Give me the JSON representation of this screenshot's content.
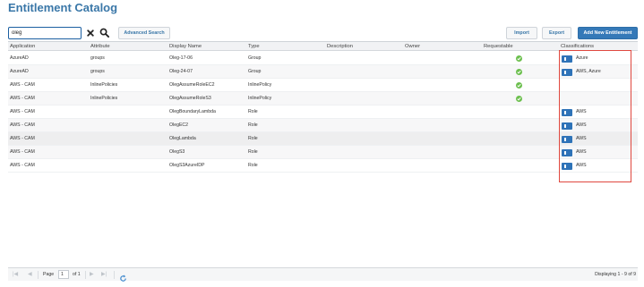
{
  "page": {
    "title": "Entitlement Catalog"
  },
  "toolbar": {
    "search_value": "oleg",
    "advanced_search": "Advanced Search",
    "import": "Import",
    "export": "Export",
    "add_new": "Add New Entitlement"
  },
  "grid": {
    "columns": [
      "Application",
      "Attribute",
      "Display Name",
      "Type",
      "Description",
      "Owner",
      "Requestable",
      "Classifications"
    ],
    "rows": [
      {
        "application": "AzureAD",
        "attribute": "groups",
        "display_name": "Oleg-17-06",
        "type": "Group",
        "description": "",
        "owner": "",
        "requestable": true,
        "classifications": "Azure"
      },
      {
        "application": "AzureAD",
        "attribute": "groups",
        "display_name": "Oleg-24-07",
        "type": "Group",
        "description": "",
        "owner": "",
        "requestable": true,
        "classifications": "AWS, Azure"
      },
      {
        "application": "AWS - CAM",
        "attribute": "InlinePolicies",
        "display_name": "OlegAssumeRoleEC2",
        "type": "InlinePolicy",
        "description": "",
        "owner": "",
        "requestable": true,
        "classifications": ""
      },
      {
        "application": "AWS - CAM",
        "attribute": "InlinePolicies",
        "display_name": "OlegAssumeRoleS3",
        "type": "InlinePolicy",
        "description": "",
        "owner": "",
        "requestable": true,
        "classifications": ""
      },
      {
        "application": "AWS - CAM",
        "attribute": "",
        "display_name": "OlegBoundaryLambda",
        "type": "Role",
        "description": "",
        "owner": "",
        "requestable": false,
        "classifications": "AWS"
      },
      {
        "application": "AWS - CAM",
        "attribute": "",
        "display_name": "OlegEC2",
        "type": "Role",
        "description": "",
        "owner": "",
        "requestable": false,
        "classifications": "AWS"
      },
      {
        "application": "AWS - CAM",
        "attribute": "",
        "display_name": "OlegLambda",
        "type": "Role",
        "description": "",
        "owner": "",
        "requestable": false,
        "classifications": "AWS"
      },
      {
        "application": "AWS - CAM",
        "attribute": "",
        "display_name": "OlegS3",
        "type": "Role",
        "description": "",
        "owner": "",
        "requestable": false,
        "classifications": "AWS"
      },
      {
        "application": "AWS - CAM",
        "attribute": "",
        "display_name": "OlegS3AzureIDP",
        "type": "Role",
        "description": "",
        "owner": "",
        "requestable": false,
        "classifications": "AWS"
      }
    ]
  },
  "pager": {
    "page_label": "Page",
    "page_value": "1",
    "of_label": "of 1",
    "displaying": "Displaying 1 - 9 of 9"
  },
  "colors": {
    "title": "#3a77a8",
    "primary_button": "#3579b8",
    "requestable_check": "#6cbf4e",
    "classification_icon": "#2e73b8",
    "highlight": "#e0483f"
  },
  "icons": {
    "clear": "close-icon",
    "search": "search-icon",
    "requestable": "check-circle-icon",
    "classification": "tag-icon",
    "first": "first-page-icon",
    "prev": "previous-page-icon",
    "next": "next-page-icon",
    "last": "last-page-icon",
    "refresh": "refresh-icon"
  }
}
